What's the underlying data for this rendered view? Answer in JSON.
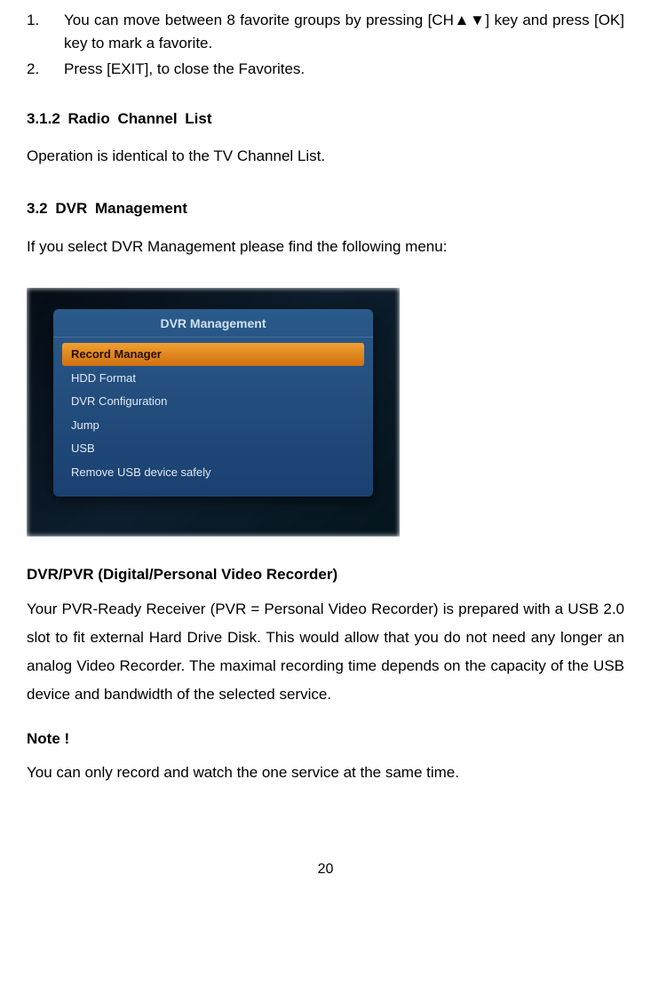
{
  "list1": {
    "num": "1.",
    "text": "You can move between 8 favorite groups by pressing [CH▲▼] key and press [OK] key to mark a favorite."
  },
  "list2": {
    "num": "2.",
    "text": "Press [EXIT], to close the Favorites."
  },
  "section_312": {
    "heading": "3.1.2   Radio  Channel  List",
    "body": "Operation is identical to the TV Channel List."
  },
  "section_32": {
    "heading": "3.2   DVR  Management",
    "intro": "If you select DVR Management please find the following menu:"
  },
  "menu": {
    "title": "DVR Management",
    "items": [
      "Record Manager",
      "HDD Format",
      "DVR Configuration",
      "Jump",
      "USB",
      "Remove USB device safely"
    ]
  },
  "dvr_section": {
    "heading": "DVR/PVR (Digital/Personal Video Recorder)",
    "body": "Your PVR-Ready Receiver (PVR = Personal Video Recorder) is prepared with a USB 2.0 slot to fit external Hard Drive Disk.   This would allow that you do not need any longer an analog Video Recorder. The maximal recording time depends on the capacity of the USB device and bandwidth of the selected service."
  },
  "note": {
    "heading": "Note !",
    "body": "You can only record and watch the one service at the same time."
  },
  "page": "20"
}
